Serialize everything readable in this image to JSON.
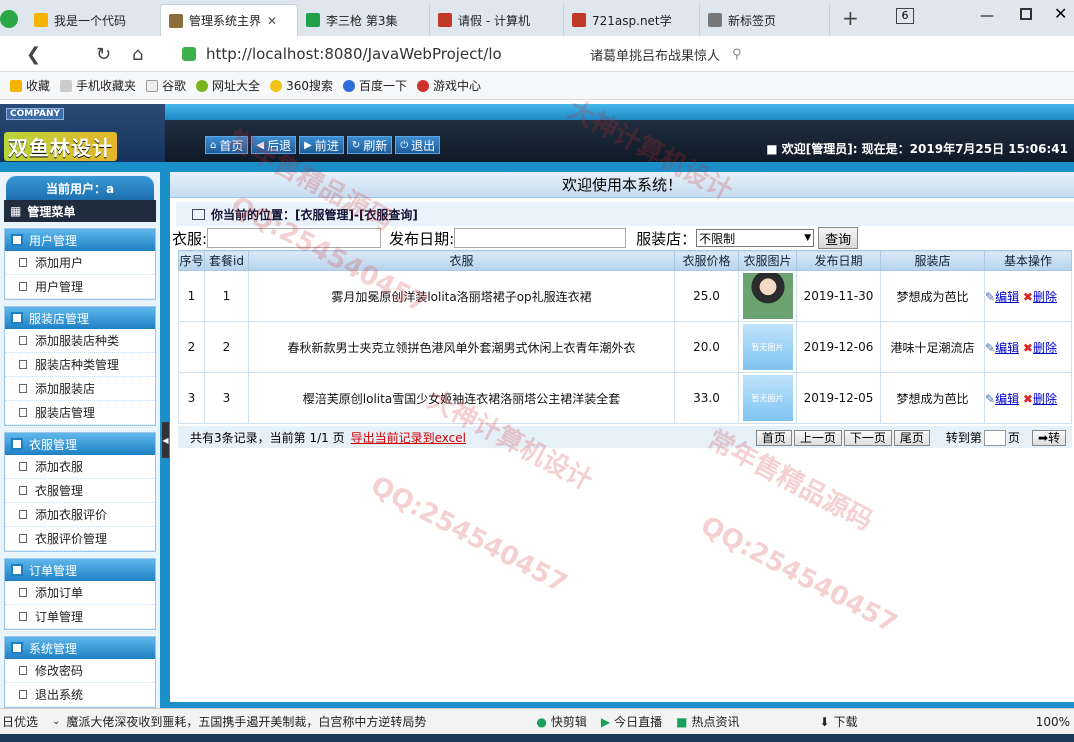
{
  "browser": {
    "tabs": [
      {
        "title": "我是一个代码",
        "color": "#f5b400"
      },
      {
        "title": "管理系统主界",
        "color": "#8a6d3b"
      },
      {
        "title": "李三枪 第3集",
        "color": "#21a249"
      },
      {
        "title": "请假 - 计算机",
        "color": "#c0392b"
      },
      {
        "title": "721asp.net学",
        "color": "#c0392b"
      },
      {
        "title": "新标签页",
        "color": "#777777"
      }
    ],
    "tab_count": "6",
    "url": "http://localhost:8080/JavaWebProject/lo",
    "search_text": "诸葛单挑吕布战果惊人",
    "bookmarks": [
      "收藏",
      "手机收藏夹",
      "谷歌",
      "网址大全",
      "360搜索",
      "百度一下",
      "游戏中心"
    ]
  },
  "header": {
    "company": "COMPANY",
    "logo": "双鱼林设计",
    "buttons": [
      "首页",
      "后退",
      "前进",
      "刷新",
      "退出"
    ],
    "welcome": "■ 欢迎[管理员]:  现在是：2019年7月25日 15:06:41"
  },
  "sidebar": {
    "current_user": "当前用户：a",
    "menu_title": "管理菜单",
    "groups": [
      {
        "title": "用户管理",
        "items": [
          "添加用户",
          "用户管理"
        ]
      },
      {
        "title": "服装店管理",
        "items": [
          "添加服装店种类",
          "服装店种类管理",
          "添加服装店",
          "服装店管理"
        ]
      },
      {
        "title": "衣服管理",
        "items": [
          "添加衣服",
          "衣服管理",
          "添加衣服评价",
          "衣服评价管理"
        ]
      },
      {
        "title": "订单管理",
        "items": [
          "添加订单",
          "订单管理"
        ]
      },
      {
        "title": "系统管理",
        "items": [
          "修改密码",
          "退出系统"
        ]
      }
    ]
  },
  "main": {
    "title": "欢迎使用本系统！",
    "location": "你当前的位置：[衣服管理]-[衣服查询]",
    "filters": {
      "cloth_label": "衣服:",
      "date_label": "发布日期:",
      "shop_label": "服装店：",
      "shop_value": "不限制",
      "query_button": "查询"
    },
    "table": {
      "headers": [
        "序号",
        "套餐id",
        "衣服",
        "衣服价格",
        "衣服图片",
        "发布日期",
        "服装店",
        "基本操作"
      ],
      "rows": [
        {
          "no": "1",
          "id": "1",
          "name": "雾月加冕原创洋装lolita洛丽塔裙子op礼服连衣裙",
          "price": "25.0",
          "image": "photo",
          "date": "2019-11-30",
          "shop": "梦想成为芭比"
        },
        {
          "no": "2",
          "id": "2",
          "name": "春秋新款男士夹克立领拼色港风单外套潮男式休闲上衣青年潮外衣",
          "price": "20.0",
          "image": "暂无图片",
          "date": "2019-12-06",
          "shop": "港味十足潮流店"
        },
        {
          "no": "3",
          "id": "3",
          "name": "樱涪芙原创lolita雪国少女姬袖连衣裙洛丽塔公主裙洋装全套",
          "price": "33.0",
          "image": "暂无图片",
          "date": "2019-12-05",
          "shop": "梦想成为芭比"
        }
      ],
      "edit_label": "编辑",
      "delete_label": "删除"
    },
    "pager": {
      "summary": "共有3条记录，当前第 1/1 页",
      "export": "导出当前记录到excel",
      "first": "首页",
      "prev": "上一页",
      "next": "下一页",
      "last": "尾页",
      "goto_label": "转到第",
      "page_suffix": "页",
      "go": "➡转"
    }
  },
  "statusbar": {
    "left": "日优选",
    "news": "魔派大佬深夜收到噩耗，五国携手遏开美制裁，白宫称中方逆转局势",
    "items": [
      "快剪辑",
      "今日直播",
      "热点资讯",
      "下载"
    ],
    "zoom": "100%"
  },
  "watermarks": [
    "QQ:254540457",
    "大神计算机设计",
    "常年售精品源码"
  ]
}
